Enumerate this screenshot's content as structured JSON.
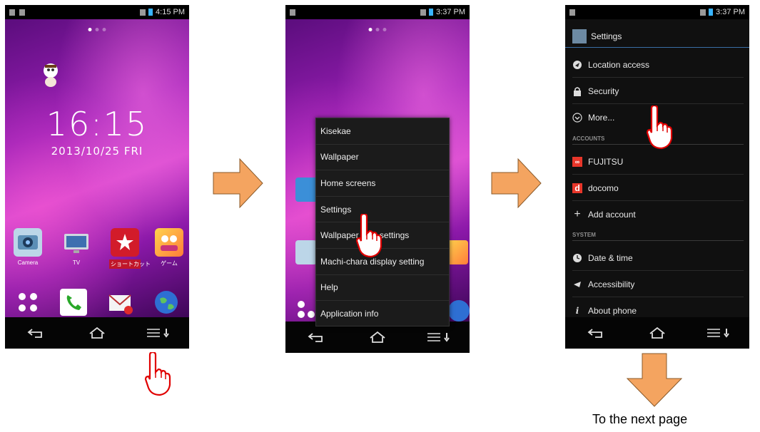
{
  "screen1": {
    "status_time": "4:15 PM",
    "clock_time": "16:15",
    "clock_date": "2013/10/25  FRI",
    "apps": [
      {
        "label": "Camera",
        "icon": "camera-icon"
      },
      {
        "label": "TV",
        "icon": "tv-icon"
      },
      {
        "label": "ショートカット",
        "icon": "star-shortcut-icon"
      },
      {
        "label": "ゲーム",
        "icon": "game-icon"
      }
    ],
    "dock": [
      "apps-grid-icon",
      "phone-icon",
      "mail-icon",
      "browser-icon"
    ]
  },
  "screen2": {
    "status_time": "3:37 PM",
    "menu_items": [
      "Kisekae",
      "Wallpaper",
      "Home screens",
      "Settings",
      "Wallpaper loop settings",
      "Machi-chara display setting",
      "Help",
      "Application info"
    ]
  },
  "screen3": {
    "status_time": "3:37 PM",
    "title": "Settings",
    "rows_top": [
      {
        "label": "Location access",
        "icon": "location-icon"
      },
      {
        "label": "Security",
        "icon": "lock-icon"
      },
      {
        "label": "More...",
        "icon": "more-icon"
      }
    ],
    "accounts_header": "ACCOUNTS",
    "rows_accounts": [
      {
        "label": "FUJITSU",
        "icon": "fujitsu-icon"
      },
      {
        "label": "docomo",
        "icon": "docomo-icon"
      },
      {
        "label": "Add account",
        "icon": "plus-icon"
      }
    ],
    "system_header": "SYSTEM",
    "rows_system": [
      {
        "label": "Date & time",
        "icon": "clock-icon"
      },
      {
        "label": "Accessibility",
        "icon": "accessibility-icon"
      },
      {
        "label": "About phone",
        "icon": "info-icon"
      }
    ]
  },
  "caption": "To the next page",
  "colors": {
    "arrow": "#f4a460",
    "hand": "#e00000",
    "wallpaper": "#9b1fb6",
    "accent": "#39b4ff"
  }
}
